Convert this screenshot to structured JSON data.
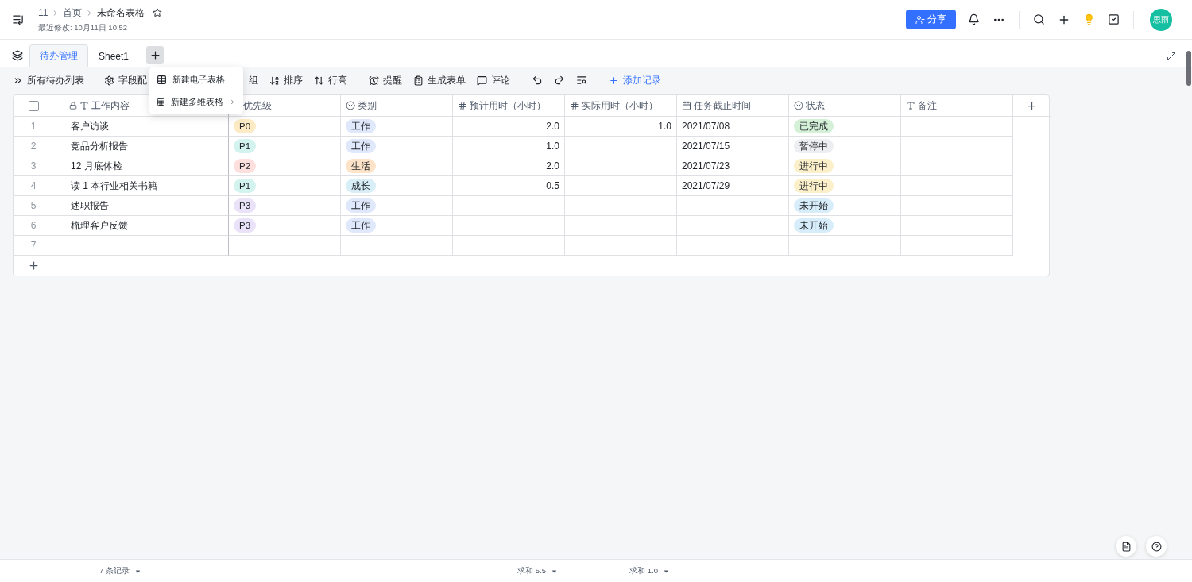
{
  "header": {
    "breadcrumb": [
      "11",
      "首页",
      "未命名表格"
    ],
    "starred": false,
    "last_modified": "最近修改: 10月11日 10:52",
    "share_label": "分享",
    "avatar": "思雨"
  },
  "tabs": [
    {
      "label": "待办管理",
      "selected": true
    },
    {
      "label": "Sheet1",
      "selected": false
    }
  ],
  "new_menu": {
    "items": [
      {
        "label": "新建电子表格",
        "kind": "sheet",
        "submenu": false
      },
      {
        "label": "新建多维表格",
        "kind": "base",
        "submenu": true
      }
    ]
  },
  "toolbar": {
    "groups": [
      {
        "items": [
          {
            "label": "所有待办列表",
            "kind": "view"
          },
          {
            "label": "字段配",
            "kind": "fields"
          },
          {
            "label": "组",
            "kind": "group"
          },
          {
            "label": "排序",
            "kind": "sort"
          },
          {
            "label": "行高",
            "kind": "height"
          }
        ]
      },
      {
        "items": [
          {
            "label": "提醒",
            "kind": "alarm"
          },
          {
            "label": "生成表单",
            "kind": "form"
          },
          {
            "label": "评论",
            "kind": "comment"
          }
        ]
      },
      {
        "items": [
          {
            "kind": "undo"
          },
          {
            "kind": "redo"
          },
          {
            "kind": "find"
          }
        ]
      },
      {
        "items": [
          {
            "label": "添加记录",
            "kind": "add"
          }
        ]
      }
    ]
  },
  "table": {
    "select_all_checked": false,
    "columns": [
      {
        "label": "工作内容",
        "kind": "primary"
      },
      {
        "label": "优先级",
        "kind": "tag"
      },
      {
        "label": "类别",
        "kind": "select"
      },
      {
        "label": "预计用时（小时）",
        "kind": "number",
        "summary": "求和 5.5"
      },
      {
        "label": "实际用时（小时）",
        "kind": "number",
        "summary": "求和 1.0"
      },
      {
        "label": "任务截止时间",
        "kind": "date"
      },
      {
        "label": "状态",
        "kind": "select"
      },
      {
        "label": "备注",
        "kind": "text"
      }
    ],
    "rows": [
      {
        "number": "1",
        "cells": [
          {
            "text": "客户访谈"
          },
          {
            "text": "P0",
            "color": "#fcebc4"
          },
          {
            "text": "工作",
            "color": "#e0e8fb"
          },
          {
            "text": "2.0"
          },
          {
            "text": "1.0"
          },
          {
            "text": "2021/07/08"
          },
          {
            "text": "已完成",
            "color": "#d4f0d7"
          },
          null
        ]
      },
      {
        "number": "2",
        "cells": [
          {
            "text": "竞品分析报告"
          },
          {
            "text": "P1",
            "color": "#d2f3ee"
          },
          {
            "text": "工作",
            "color": "#e0e8fb"
          },
          {
            "text": "1.0"
          },
          null,
          {
            "text": "2021/07/15"
          },
          {
            "text": "暂停中",
            "color": "#eceef1"
          },
          null
        ]
      },
      {
        "number": "3",
        "cells": [
          {
            "text": "12 月底体检"
          },
          {
            "text": "P2",
            "color": "#fde0de"
          },
          {
            "text": "生活",
            "color": "#fde4c8"
          },
          {
            "text": "2.0"
          },
          null,
          {
            "text": "2021/07/23"
          },
          {
            "text": "进行中",
            "color": "#fbf0c9"
          },
          null
        ]
      },
      {
        "number": "4",
        "cells": [
          {
            "text": "读 1 本行业相关书籍"
          },
          {
            "text": "P1",
            "color": "#d2f3ee"
          },
          {
            "text": "成长",
            "color": "#d8eff8"
          },
          {
            "text": "0.5"
          },
          null,
          {
            "text": "2021/07/29"
          },
          {
            "text": "进行中",
            "color": "#fbf0c9"
          },
          null
        ]
      },
      {
        "number": "5",
        "cells": [
          {
            "text": "述职报告"
          },
          {
            "text": "P3",
            "color": "#e9e2f8"
          },
          {
            "text": "工作",
            "color": "#e0e8fb"
          },
          null,
          null,
          null,
          {
            "text": "未开始",
            "color": "#d8edfa"
          },
          null
        ]
      },
      {
        "number": "6",
        "cells": [
          {
            "text": "梳理客户反馈"
          },
          {
            "text": "P3",
            "color": "#e9e2f8"
          },
          {
            "text": "工作",
            "color": "#e0e8fb"
          },
          null,
          null,
          null,
          {
            "text": "未开始",
            "color": "#d8edfa"
          },
          null
        ]
      },
      {
        "number": "7",
        "cells": [
          null,
          null,
          null,
          null,
          null,
          null,
          null,
          null
        ]
      }
    ]
  },
  "footer": {
    "record_count": "7 条记录"
  }
}
